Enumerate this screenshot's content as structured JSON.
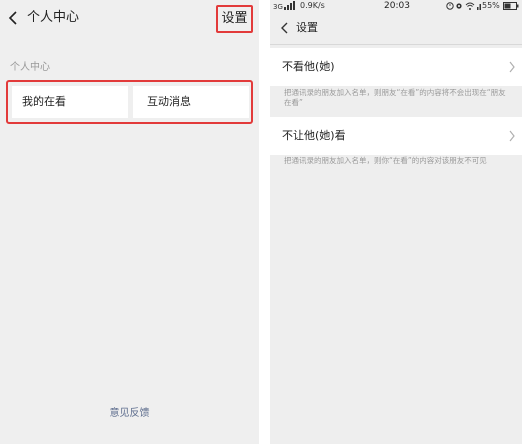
{
  "left_screen": {
    "title": "个人中心",
    "settings_label": "设置",
    "section_label": "个人中心",
    "tiles": [
      {
        "label": "我的在看"
      },
      {
        "label": "互动消息"
      }
    ],
    "feedback_label": "意见反馈",
    "highlight_color": "#e23a3a"
  },
  "right_screen": {
    "status_bar": {
      "network": "3G",
      "speed": "0.9K/s",
      "time": "20:03",
      "battery": "55%"
    },
    "title": "设置",
    "rows": [
      {
        "label": "不看他(她)",
        "description": "把通讯录的朋友加入名单，则朋友“在看”的内容将不会出现在“朋友在看”"
      },
      {
        "label": "不让他(她)看",
        "description": "把通讯录的朋友加入名单，则你“在看”的内容对该朋友不可见"
      }
    ]
  },
  "icons": {
    "back": "chevron-left-icon",
    "row_arrow": "chevron-right-icon"
  }
}
